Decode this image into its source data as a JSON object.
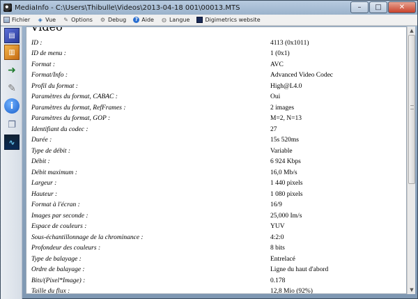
{
  "window": {
    "title": "MediaInfo - C:\\Users\\Thibulle\\Videos\\2013-04-18 001\\00013.MTS",
    "controls": {
      "minimize": "–",
      "maximize": "□",
      "close": "✕"
    }
  },
  "menu": {
    "items": [
      {
        "label": "Fichier",
        "icon": "file-icon"
      },
      {
        "label": "Vue",
        "icon": "view-icon"
      },
      {
        "label": "Options",
        "icon": "options-icon"
      },
      {
        "label": "Debug",
        "icon": "debug-icon"
      },
      {
        "label": "Aide",
        "icon": "help-icon"
      },
      {
        "label": "Langue",
        "icon": "language-icon"
      },
      {
        "label": "Digimetrics website",
        "icon": "digimetrics-icon"
      }
    ]
  },
  "sidebar": {
    "icons": [
      "open-file-icon",
      "open-folder-icon",
      "export-icon",
      "options-icon",
      "about-icon",
      "knowledge-base-icon",
      "digimetrics-icon"
    ]
  },
  "content": {
    "section_heading": "Vidéo",
    "rows": [
      {
        "label": "ID :",
        "value": "4113 (0x1011)"
      },
      {
        "label": "ID de menu :",
        "value": "1 (0x1)"
      },
      {
        "label": "Format :",
        "value": "AVC"
      },
      {
        "label": "Format/Info :",
        "value": "Advanced Video Codec"
      },
      {
        "label": "Profil du format :",
        "value": "High@L4.0"
      },
      {
        "label": "Paramètres du format, CABAC :",
        "value": "Oui"
      },
      {
        "label": "Paramètres du format, RefFrames :",
        "value": "2 images"
      },
      {
        "label": "Paramètres du format, GOP :",
        "value": "M=2, N=13"
      },
      {
        "label": "Identifiant du codec :",
        "value": "27"
      },
      {
        "label": "Durée :",
        "value": "15s 520ms"
      },
      {
        "label": "Type de débit :",
        "value": "Variable"
      },
      {
        "label": "Débit :",
        "value": "6 924 Kbps"
      },
      {
        "label": "Débit maximum :",
        "value": "16,0 Mb/s"
      },
      {
        "label": "Largeur :",
        "value": "1 440 pixels"
      },
      {
        "label": "Hauteur :",
        "value": "1 080 pixels"
      },
      {
        "label": "Format à l'écran :",
        "value": "16/9"
      },
      {
        "label": "Images par seconde :",
        "value": "25,000 Im/s"
      },
      {
        "label": "Espace de couleurs :",
        "value": "YUV"
      },
      {
        "label": "Sous-échantillonnage de la chrominance :",
        "value": "4:2:0"
      },
      {
        "label": "Profondeur des couleurs :",
        "value": "8 bits"
      },
      {
        "label": "Type de balayage :",
        "value": "Entrelacé"
      },
      {
        "label": "Ordre de balayage :",
        "value": "Ligne du haut d'abord"
      },
      {
        "label": "Bits/(Pixel*Image) :",
        "value": "0.178"
      },
      {
        "label": "Taille du flux :",
        "value": "12,8 Mio (92%)"
      }
    ]
  }
}
